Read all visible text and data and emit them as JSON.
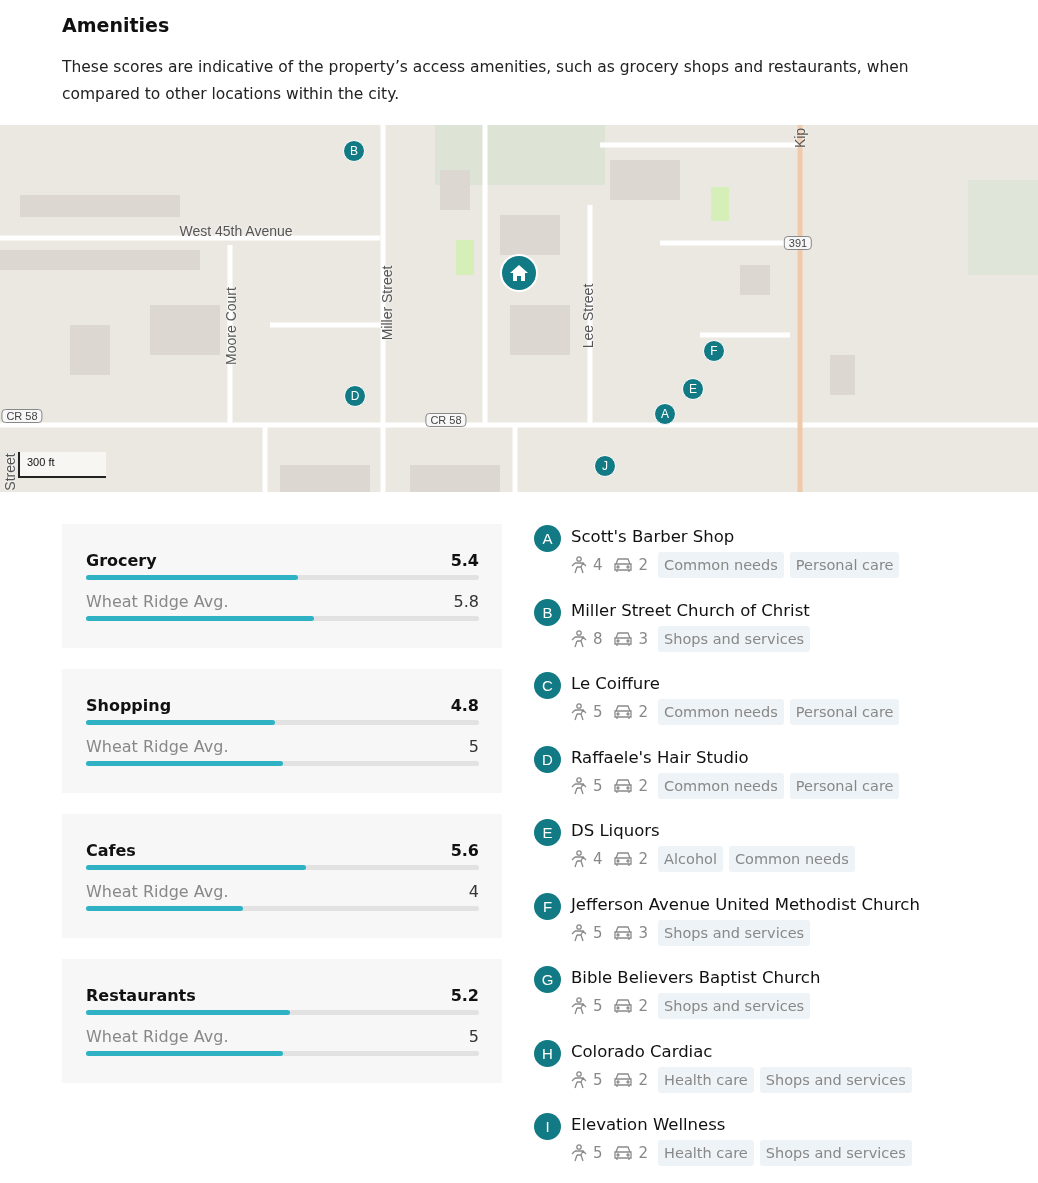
{
  "section": {
    "title": "Amenities",
    "description": "These scores are indicative of the property’s access amenities, such as grocery shops and restaurants, when compared to other locations within the city."
  },
  "map": {
    "labels": [
      {
        "text": "West 45th Avenue",
        "kind": "horizontal"
      },
      {
        "text": "Moore Court",
        "kind": "vertical"
      },
      {
        "text": "Miller Street",
        "kind": "vertical"
      },
      {
        "text": "Lee Street",
        "kind": "vertical"
      },
      {
        "text": "CR 58",
        "kind": "shield"
      },
      {
        "text": "CR 58",
        "kind": "shield"
      },
      {
        "text": "391",
        "kind": "shield"
      },
      {
        "text": "Kip",
        "kind": "vertical"
      },
      {
        "text": "Street",
        "kind": "vertical"
      }
    ],
    "pins": [
      "B",
      "D",
      "E",
      "F",
      "A",
      "J"
    ],
    "scale": "300 ft"
  },
  "scores": [
    {
      "name": "Grocery",
      "score": "5.4",
      "level": 0.54,
      "average": {
        "label": "Wheat Ridge Avg.",
        "value": "5.8",
        "level": 0.58
      }
    },
    {
      "name": "Shopping",
      "score": "4.8",
      "level": 0.48,
      "average": {
        "label": "Wheat Ridge Avg.",
        "value": "5",
        "level": 0.5
      }
    },
    {
      "name": "Cafes",
      "score": "5.6",
      "level": 0.56,
      "average": {
        "label": "Wheat Ridge Avg.",
        "value": "4",
        "level": 0.4
      }
    },
    {
      "name": "Restaurants",
      "score": "5.2",
      "level": 0.52,
      "average": {
        "label": "Wheat Ridge Avg.",
        "value": "5",
        "level": 0.5
      }
    }
  ],
  "places": [
    {
      "letter": "A",
      "name": "Scott's Barber Shop",
      "walk": "4",
      "drive": "2",
      "tags": [
        "Common needs",
        "Personal care"
      ]
    },
    {
      "letter": "B",
      "name": "Miller Street Church of Christ",
      "walk": "8",
      "drive": "3",
      "tags": [
        "Shops and services"
      ]
    },
    {
      "letter": "C",
      "name": "Le Coiffure",
      "walk": "5",
      "drive": "2",
      "tags": [
        "Common needs",
        "Personal care"
      ]
    },
    {
      "letter": "D",
      "name": "Raffaele's Hair Studio",
      "walk": "5",
      "drive": "2",
      "tags": [
        "Common needs",
        "Personal care"
      ]
    },
    {
      "letter": "E",
      "name": "DS Liquors",
      "walk": "4",
      "drive": "2",
      "tags": [
        "Alcohol",
        "Common needs"
      ]
    },
    {
      "letter": "F",
      "name": "Jefferson Avenue United Methodist Church",
      "walk": "5",
      "drive": "3",
      "tags": [
        "Shops and services"
      ]
    },
    {
      "letter": "G",
      "name": "Bible Believers Baptist Church",
      "walk": "5",
      "drive": "2",
      "tags": [
        "Shops and services"
      ]
    },
    {
      "letter": "H",
      "name": "Colorado Cardiac",
      "walk": "5",
      "drive": "2",
      "tags": [
        "Health care",
        "Shops and services"
      ]
    },
    {
      "letter": "I",
      "name": "Elevation Wellness",
      "walk": "5",
      "drive": "2",
      "tags": [
        "Health care",
        "Shops and services"
      ]
    }
  ]
}
